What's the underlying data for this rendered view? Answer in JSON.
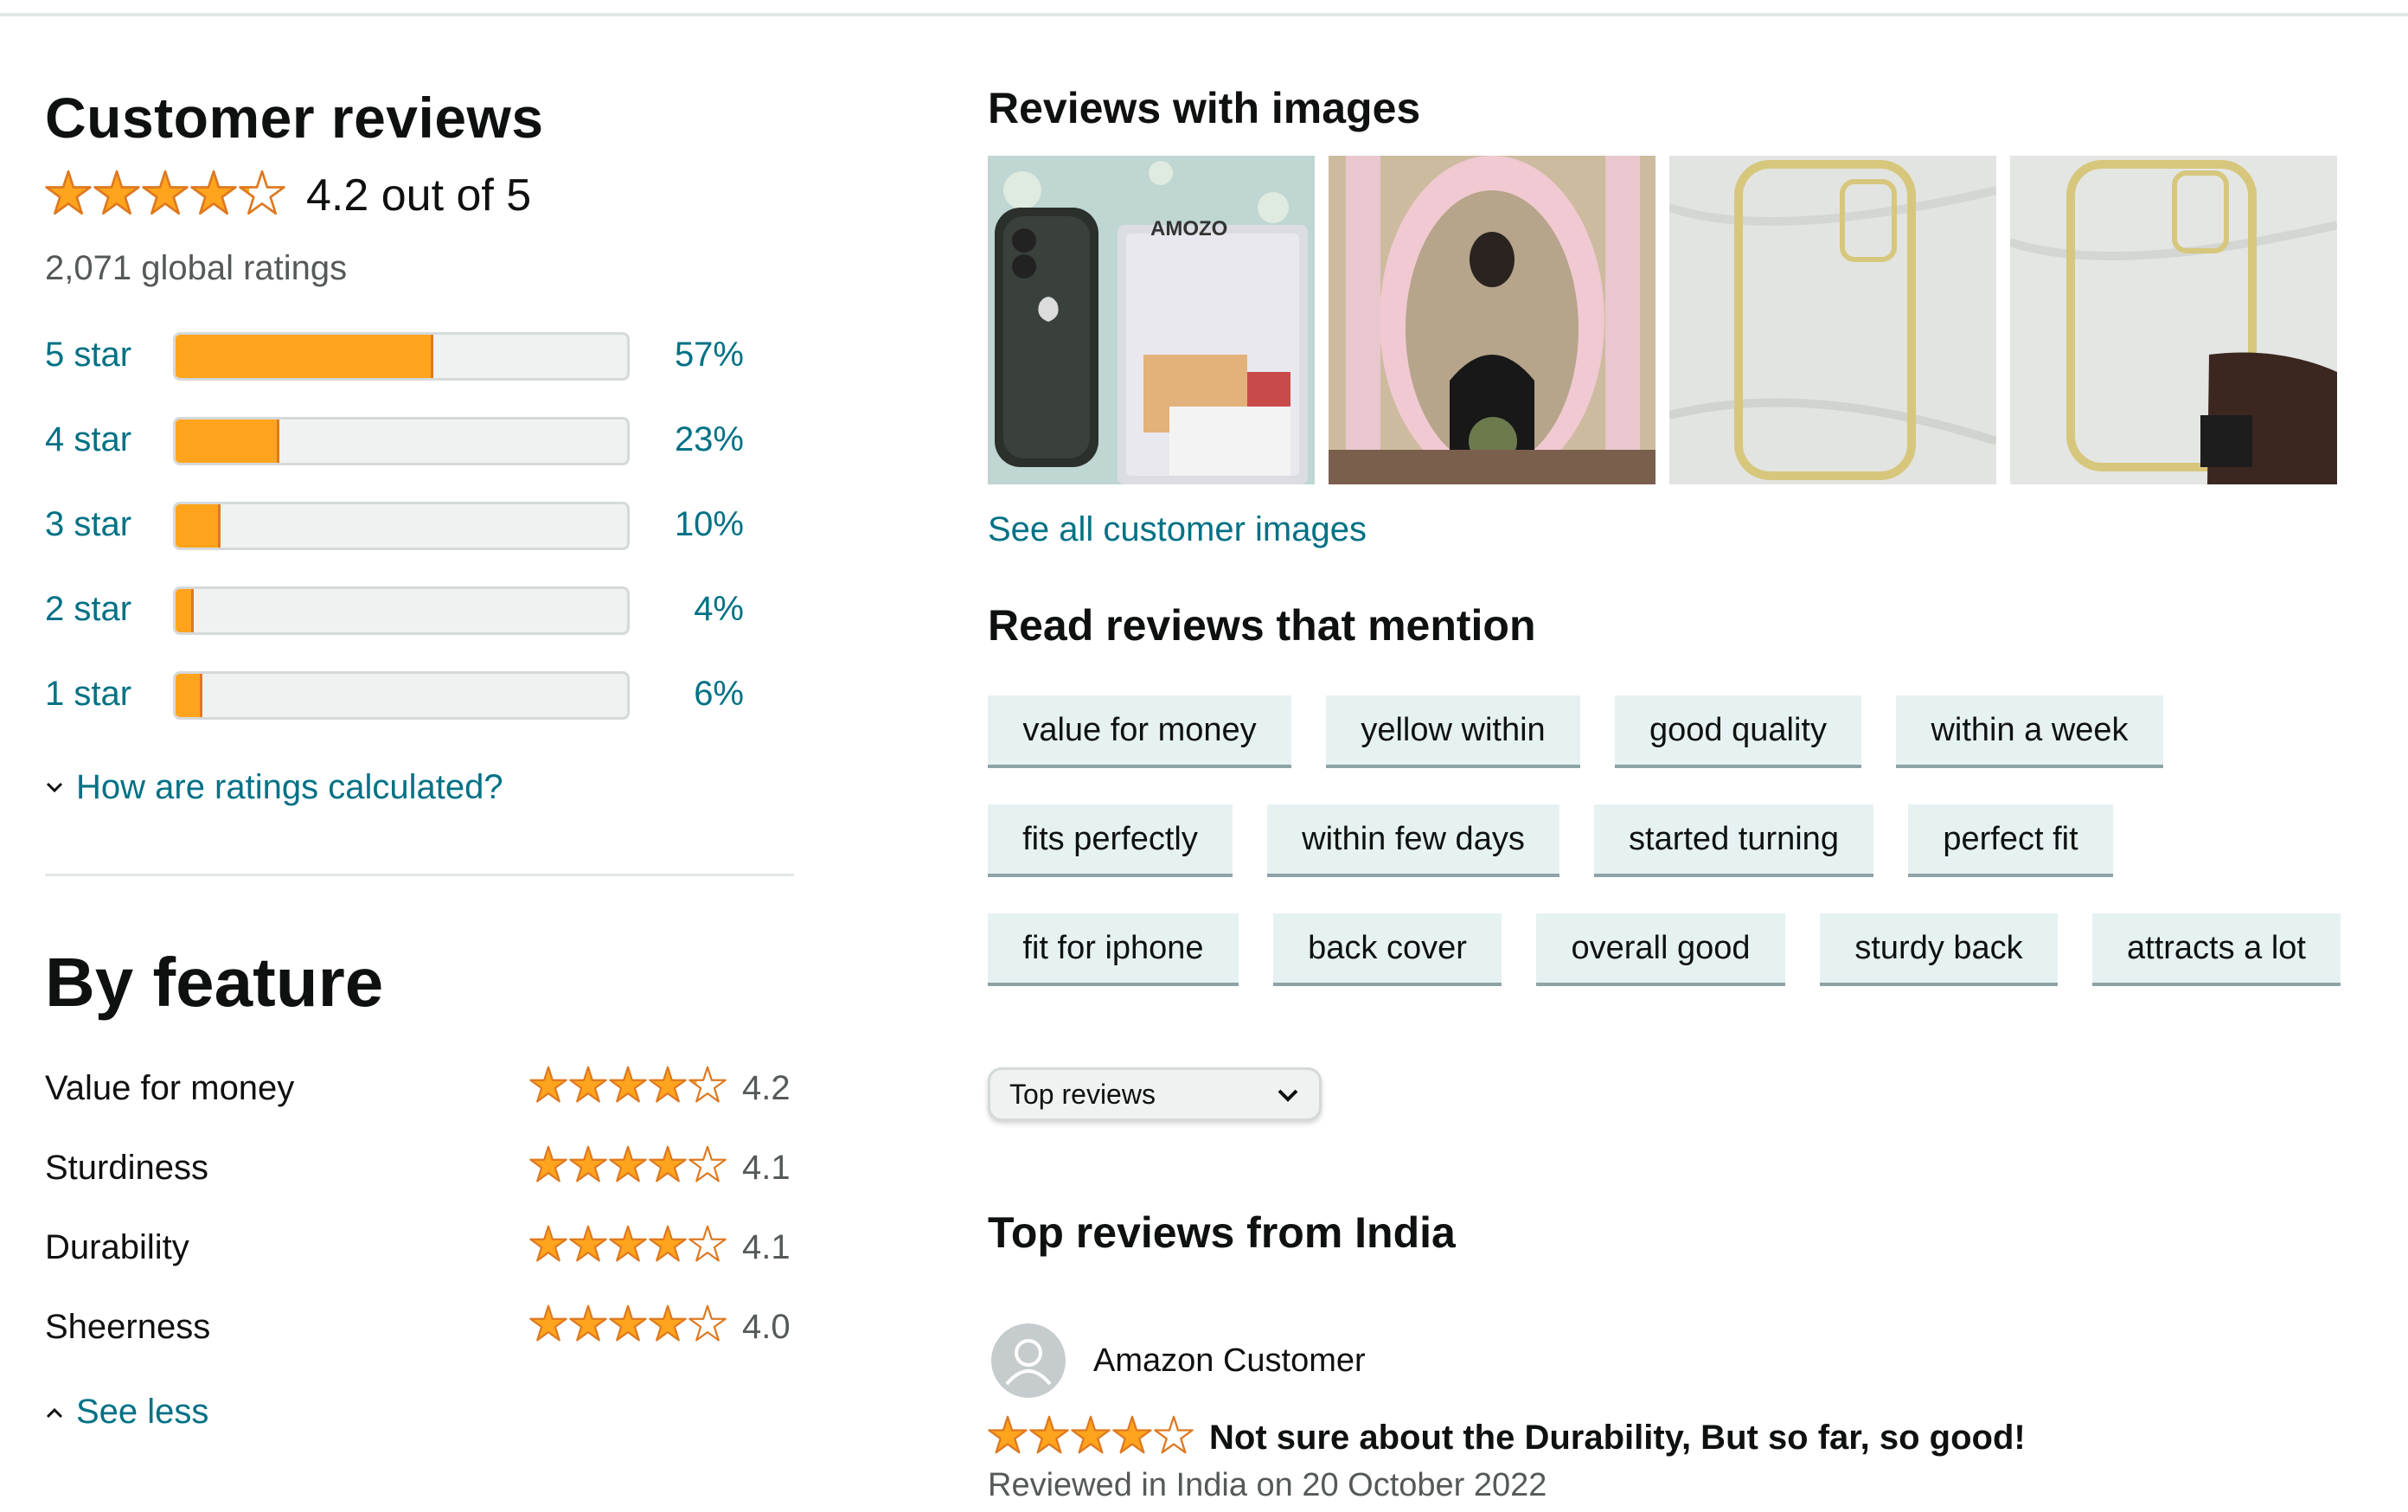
{
  "summary": {
    "title": "Customer reviews",
    "rating": 4.2,
    "rating_text": "4.2 out of 5",
    "global_ratings": "2,071 global ratings",
    "histogram": [
      {
        "label": "5 star",
        "percent": 57,
        "percent_text": "57%"
      },
      {
        "label": "4 star",
        "percent": 23,
        "percent_text": "23%"
      },
      {
        "label": "3 star",
        "percent": 10,
        "percent_text": "10%"
      },
      {
        "label": "2 star",
        "percent": 4,
        "percent_text": "4%"
      },
      {
        "label": "1 star",
        "percent": 6,
        "percent_text": "6%"
      }
    ],
    "how_link": "How are ratings calculated?"
  },
  "features": {
    "title": "By feature",
    "items": [
      {
        "name": "Value for money",
        "rating": 4.2,
        "score": "4.2"
      },
      {
        "name": "Sturdiness",
        "rating": 4.1,
        "score": "4.1"
      },
      {
        "name": "Durability",
        "rating": 4.1,
        "score": "4.1"
      },
      {
        "name": "Sheerness",
        "rating": 4.0,
        "score": "4.0"
      }
    ],
    "see_less": "See less"
  },
  "images": {
    "title": "Reviews with images",
    "see_all": "See all customer images",
    "thumbnails": [
      "phone-with-case-packaging",
      "mirror-selfie",
      "clear-case-on-bed",
      "clear-case-in-hand"
    ]
  },
  "mentions": {
    "title": "Read reviews that mention",
    "rows": [
      [
        "value for money",
        "yellow within",
        "good quality",
        "within a week"
      ],
      [
        "fits perfectly",
        "within few days",
        "started turning",
        "perfect fit"
      ],
      [
        "fit for iphone",
        "back cover",
        "overall good",
        "sturdy back",
        "attracts a lot"
      ]
    ]
  },
  "sort": {
    "selected": "Top reviews"
  },
  "top_reviews": {
    "title": "Top reviews from India",
    "review": {
      "author": "Amazon Customer",
      "rating": 4,
      "headline": "Not sure about the Durability, But so far, so good!",
      "meta": "Reviewed in India on 20 October 2022"
    }
  },
  "colors": {
    "star": "#ffa41c",
    "star_outline": "#de7921",
    "link": "#007185",
    "chip_bg": "#e6f1f2"
  }
}
